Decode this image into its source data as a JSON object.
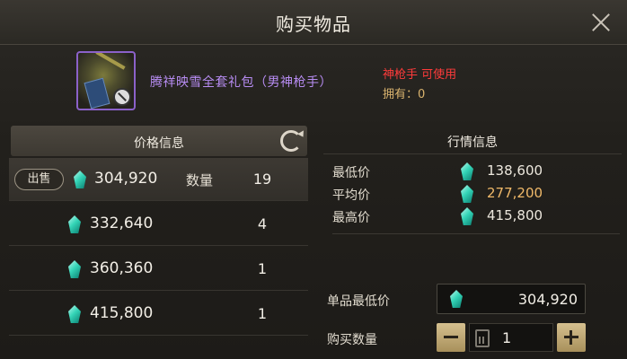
{
  "window": {
    "title": "购买物品"
  },
  "item": {
    "name": "腾祥映雪全套礼包（男神枪手）",
    "class_tag": "神枪手 可使用",
    "owned": "拥有：0"
  },
  "price_panel": {
    "header": "价格信息",
    "sell_label": "出售",
    "qty_label": "数量",
    "rows": [
      {
        "price": "304,920",
        "qty": "19",
        "selected": true
      },
      {
        "price": "332,640",
        "qty": "4",
        "selected": false
      },
      {
        "price": "360,360",
        "qty": "1",
        "selected": false
      },
      {
        "price": "415,800",
        "qty": "1",
        "selected": false
      }
    ]
  },
  "market_panel": {
    "header": "行情信息",
    "rows": [
      {
        "label": "最低价",
        "value": "138,600"
      },
      {
        "label": "平均价",
        "value": "277,200"
      },
      {
        "label": "最高价",
        "value": "415,800"
      }
    ]
  },
  "purchase": {
    "unit_low_label": "单品最低价",
    "unit_low_value": "304,920",
    "buy_qty_label": "购买数量",
    "buy_qty_value": "1"
  },
  "colors": {
    "item_name": "#b78cf2",
    "class_tag": "#ff3b3b",
    "owned": "#d9b36e",
    "avg_price": "#f0b969",
    "gem": "#35d6b8"
  },
  "icons": [
    "close-icon",
    "refresh-icon",
    "gem-icon",
    "calculator-icon",
    "minus-icon",
    "plus-icon",
    "forbidden-icon"
  ]
}
